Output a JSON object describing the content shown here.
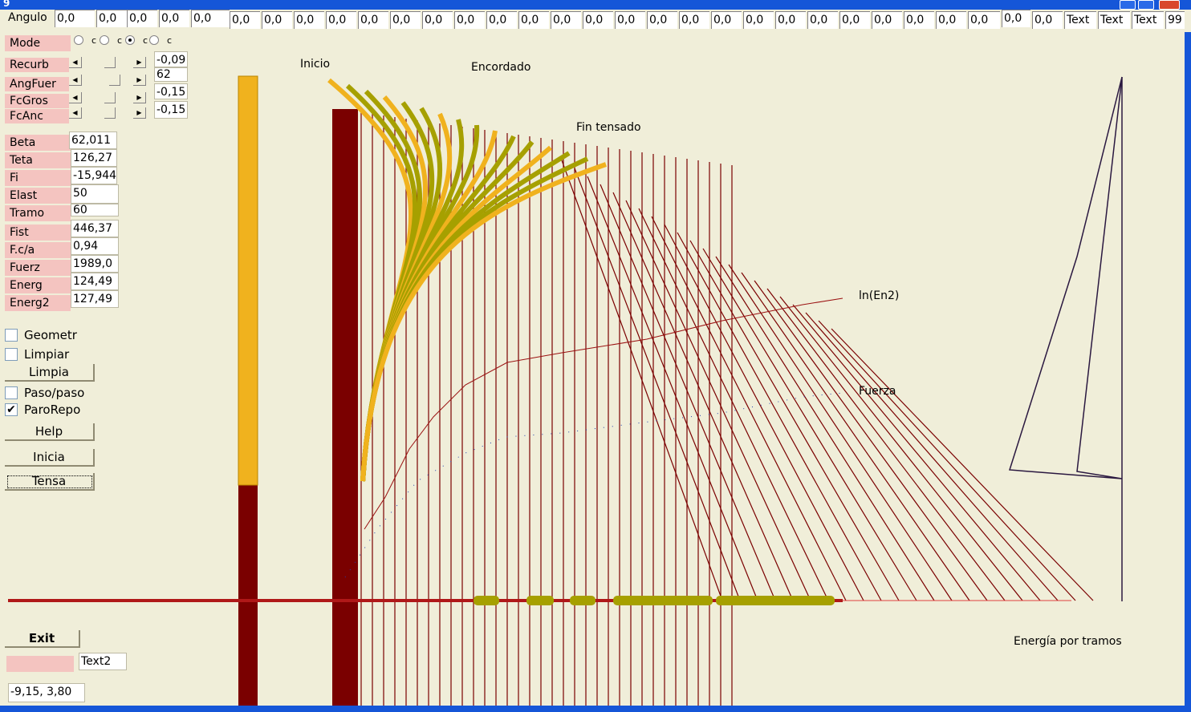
{
  "window": {
    "title": "9"
  },
  "top_strip": {
    "angulo_label": "Angulo",
    "fields": [
      "0,0",
      "0,0",
      "0,0",
      "0,0",
      "0,0",
      "0,0",
      "0,0",
      "0,0",
      "0,0",
      "0,0",
      "0,0",
      "0,0",
      "0,0",
      "0,0",
      "0,0",
      "0,0",
      "0,0",
      "0,0",
      "0,0",
      "0,0",
      "0,0",
      "0,0",
      "0,0",
      "0,0",
      "0,0",
      "0,0",
      "0,0",
      "0,0",
      "0,0",
      "0,0"
    ],
    "text_fields": [
      "Text",
      "Text",
      "Text",
      "99"
    ]
  },
  "mode": {
    "label": "Mode",
    "options": [
      "c",
      "c",
      "c",
      "c"
    ],
    "selected_index": 2
  },
  "sliders": [
    {
      "label": "Recurb",
      "value": "-0,09"
    },
    {
      "label": "AngFuer",
      "value": "62"
    },
    {
      "label": "FcGros",
      "value": "-0,15"
    },
    {
      "label": "FcAnc",
      "value": "-0,15"
    }
  ],
  "params": [
    {
      "label": "Beta",
      "value": "62,011"
    },
    {
      "label": "Teta",
      "value": "126,27"
    },
    {
      "label": "Fi",
      "value": "-15,944"
    },
    {
      "label": "Elast",
      "value": "50"
    },
    {
      "label": "Tramo",
      "value": "60"
    },
    {
      "label": "Fist",
      "value": "446,37"
    },
    {
      "label": "F.c/a",
      "value": "0,94"
    },
    {
      "label": "Fuerz",
      "value": "1989,0"
    },
    {
      "label": "Energ",
      "value": "124,49"
    },
    {
      "label": "Energ2",
      "value": "127,49"
    }
  ],
  "checkboxes": {
    "geometr": {
      "label": "Geometr",
      "checked": false
    },
    "limpiar": {
      "label": "Limpiar",
      "checked": false
    },
    "paso": {
      "label": "Paso/paso",
      "checked": false
    },
    "paro": {
      "label": "ParoRepo",
      "checked": true
    }
  },
  "buttons": {
    "limpia": "Limpia",
    "help": "Help",
    "inicia": "Inicia",
    "tensa": "Tensa",
    "exit": "Exit"
  },
  "bottom": {
    "text2": "Text2",
    "coords": "-9,15, 3,80"
  },
  "canvas_labels": {
    "inicio": "Inicio",
    "encordado": "Encordado",
    "fin_tensado": "Fin tensado",
    "ln_en2": "ln(En2)",
    "fuerza": "Fuerza",
    "energia": "Energía por tramos"
  },
  "colors": {
    "limb": "#f0b21e",
    "limb_olive": "#a6a000",
    "string": "#7a0000",
    "blue": "#1c2fa0",
    "pink": "#f4c4c0",
    "title": "#1556d8"
  }
}
